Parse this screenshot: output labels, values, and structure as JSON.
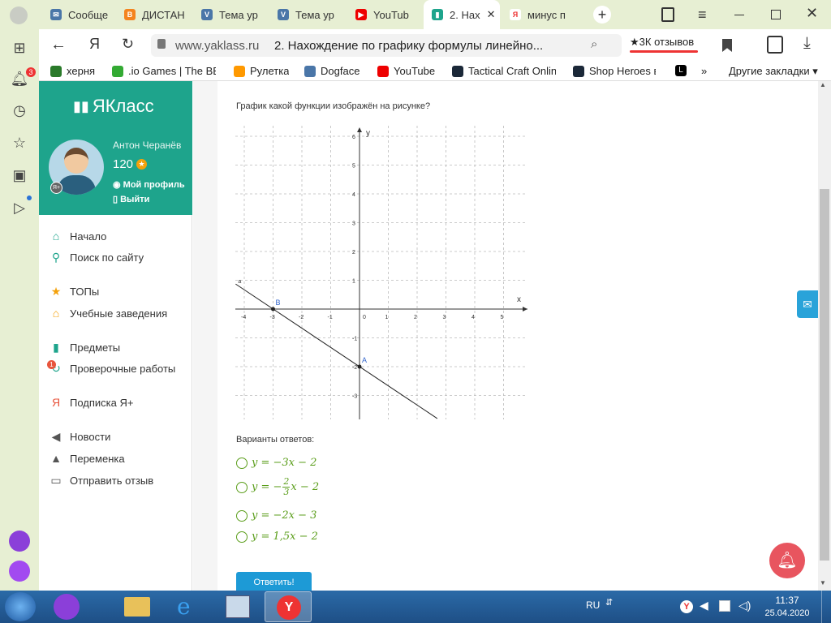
{
  "tabs": [
    {
      "label": "Сообще",
      "color": "#4a76a8",
      "glyph": "✉"
    },
    {
      "label": "ДИСТАН",
      "color": "#f4841f",
      "glyph": "B"
    },
    {
      "label": "Тема ур",
      "color": "#4a76a8",
      "glyph": "V"
    },
    {
      "label": "Тема ур",
      "color": "#4a76a8",
      "glyph": "V"
    },
    {
      "label": "YouTub",
      "color": "#e00",
      "glyph": "▶"
    },
    {
      "label": "2. Нах",
      "color": "#1ea48c",
      "glyph": "▮"
    },
    {
      "label": "минус п",
      "color": "#fff",
      "glyph": "Я"
    }
  ],
  "address": {
    "domain": "www.yaklass.ru",
    "title": "2. Нахождение по графику формулы линейно...",
    "reviews": "★3К отзывов"
  },
  "bookmarks": [
    {
      "label": "херня",
      "color": "#2a7a2a"
    },
    {
      "label": ".io Games | The BE",
      "color": "#3a3"
    },
    {
      "label": "Рулетка",
      "color": "#f90"
    },
    {
      "label": "Dogface",
      "color": "#4a76a8"
    },
    {
      "label": "YouTube",
      "color": "#e00"
    },
    {
      "label": "Tactical Craft Onlin",
      "color": "#1b2838"
    },
    {
      "label": "Shop Heroes в",
      "color": "#1b2838"
    },
    {
      "label": "L",
      "color": "#000"
    }
  ],
  "bookmarks_more": "»",
  "bookmarks_other": "Другие закладки ▾",
  "notif_badge": "3",
  "brand": "ЯКласс",
  "user": {
    "name": "Антон Черанёв",
    "points": "120",
    "profile": "Мой профиль",
    "logout": "Выйти"
  },
  "menu": [
    {
      "label": "Начало",
      "icon": "home-icon",
      "color": "#1ea48c",
      "glyph": "⌂"
    },
    {
      "label": "Поиск по сайту",
      "icon": "search-icon",
      "color": "#1ea48c",
      "glyph": "⚲"
    },
    {
      "label": "ТОПы",
      "icon": "star-icon",
      "color": "#f4a10b",
      "glyph": "★"
    },
    {
      "label": "Учебные заведения",
      "icon": "building-icon",
      "color": "#f4a10b",
      "glyph": "⌂"
    },
    {
      "label": "Предметы",
      "icon": "books-icon",
      "color": "#1ea48c",
      "glyph": "▮"
    },
    {
      "label": "Проверочные работы",
      "icon": "check-icon",
      "color": "#1ea48c",
      "glyph": "↻"
    },
    {
      "label": "Подписка Я+",
      "icon": "yaplus-icon",
      "color": "#e8553d",
      "glyph": "Я"
    },
    {
      "label": "Новости",
      "icon": "megaphone-icon",
      "color": "#555",
      "glyph": "◀"
    },
    {
      "label": "Переменка",
      "icon": "bell-icon",
      "color": "#555",
      "glyph": "▲"
    },
    {
      "label": "Отправить отзыв",
      "icon": "feedback-icon",
      "color": "#555",
      "glyph": "▭"
    }
  ],
  "menu_badge": "1",
  "question": "График какой функции изображён на рисунке?",
  "graph": {
    "x_label": "x",
    "y_label": "y",
    "x_ticks": [
      "-4",
      "-3",
      "-2",
      "-1",
      "0",
      "1",
      "2",
      "3",
      "4",
      "5"
    ],
    "y_ticks": [
      "6",
      "5",
      "4",
      "3",
      "2",
      "1",
      "-1",
      "-2",
      "-3"
    ],
    "point_a": "A",
    "point_b": "B",
    "line_label": "a",
    "line": {
      "x1": -4.3,
      "y1": 0.87,
      "x2": 2.7,
      "y2": -3.8
    }
  },
  "answers_title": "Варианты ответов:",
  "answers": [
    {
      "lhs": "y = −3x − 2"
    },
    {
      "lhs": "y = −",
      "num": "2",
      "den": "3",
      "rhs": "x − 2"
    },
    {
      "lhs": "y = −2x − 3"
    },
    {
      "lhs": "y = 1,5x − 2"
    }
  ],
  "submit": "Ответить!",
  "taskbar": {
    "lang": "RU",
    "time": "11:37",
    "date": "25.04.2020"
  }
}
